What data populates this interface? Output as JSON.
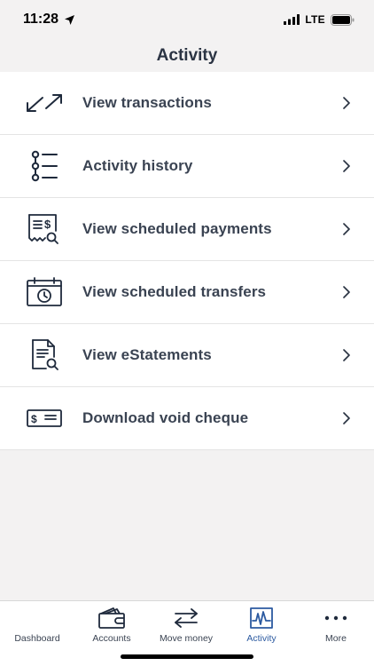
{
  "status": {
    "time": "11:28",
    "network": "LTE"
  },
  "header": {
    "title": "Activity"
  },
  "menu": {
    "items": [
      {
        "label": "View transactions",
        "icon": "arrows-diagonal-icon"
      },
      {
        "label": "Activity history",
        "icon": "list-timeline-icon"
      },
      {
        "label": "View scheduled payments",
        "icon": "receipt-search-icon"
      },
      {
        "label": "View scheduled transfers",
        "icon": "calendar-clock-icon"
      },
      {
        "label": "View eStatements",
        "icon": "document-search-icon"
      },
      {
        "label": "Download void cheque",
        "icon": "cheque-icon"
      }
    ]
  },
  "tabbar": {
    "tabs": [
      {
        "label": "Dashboard",
        "icon": "dashboard-icon",
        "active": false
      },
      {
        "label": "Accounts",
        "icon": "wallet-icon",
        "active": false
      },
      {
        "label": "Move money",
        "icon": "transfer-arrows-icon",
        "active": false
      },
      {
        "label": "Activity",
        "icon": "activity-pulse-icon",
        "active": true
      },
      {
        "label": "More",
        "icon": "more-dots-icon",
        "active": false
      }
    ]
  },
  "colors": {
    "accent": "#2c5aa0",
    "text": "#3a4352",
    "icon": "#1f2a3c",
    "background": "#f3f2f2"
  }
}
